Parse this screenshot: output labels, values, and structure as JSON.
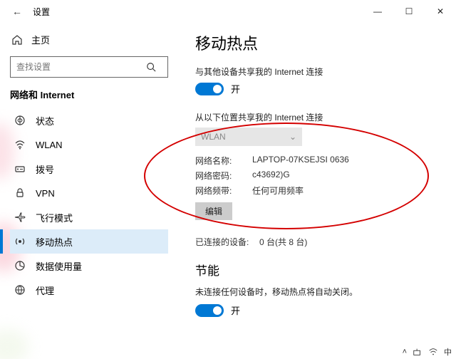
{
  "window": {
    "title": "设置",
    "minimize": "—",
    "maximize": "☐",
    "close": "✕"
  },
  "sidebar": {
    "home": "主页",
    "search_placeholder": "查找设置",
    "group": "网络和 Internet",
    "items": [
      {
        "icon": "status",
        "label": "状态"
      },
      {
        "icon": "wifi",
        "label": "WLAN"
      },
      {
        "icon": "dialup",
        "label": "拨号"
      },
      {
        "icon": "vpn",
        "label": "VPN"
      },
      {
        "icon": "airplane",
        "label": "飞行模式"
      },
      {
        "icon": "hotspot",
        "label": "移动热点"
      },
      {
        "icon": "datausage",
        "label": "数据使用量"
      },
      {
        "icon": "proxy",
        "label": "代理"
      }
    ]
  },
  "content": {
    "title": "移动热点",
    "share_label": "与其他设备共享我的 Internet 连接",
    "toggle_on": "开",
    "from_label": "从以下位置共享我的 Internet 连接",
    "wlan_option": "WLAN",
    "net_name_k": "网络名称:",
    "net_name_v": "LAPTOP-07KSEJSI 0636",
    "net_pwd_k": "网络密码:",
    "net_pwd_v": "c43692)G",
    "net_band_k": "网络频带:",
    "net_band_v": "任何可用频率",
    "edit": "编辑",
    "connected_k": "已连接的设备:",
    "connected_v": "0 台(共 8 台)",
    "save_title": "节能",
    "save_desc": "未连接任何设备时，移动热点将自动关闭。"
  },
  "tray": {
    "ime": "中"
  }
}
